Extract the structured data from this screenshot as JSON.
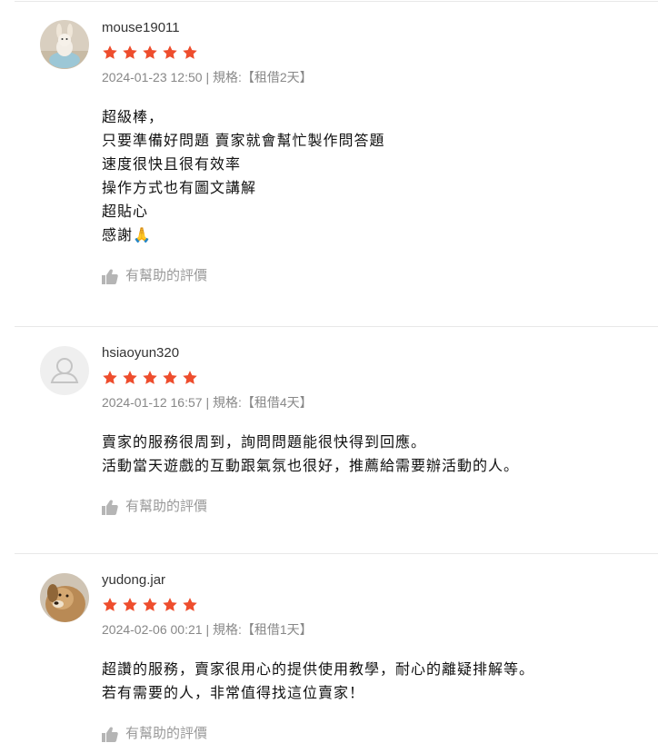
{
  "reviews": [
    {
      "username": "mouse19011",
      "rating": 5,
      "date": "2024-01-23 12:50",
      "separator": "|",
      "spec": "規格:【租借2天】",
      "lines": [
        "超級棒，",
        "只要準備好問題 賣家就會幫忙製作問答題",
        "速度很快且很有效率",
        "操作方式也有圖文講解",
        "超貼心",
        "感謝🙏"
      ],
      "helpful_label": "有幫助的評價",
      "avatar": "rabbit-figurine-photo"
    },
    {
      "username": "hsiaoyun320",
      "rating": 5,
      "date": "2024-01-12 16:57",
      "separator": "|",
      "spec": "規格:【租借4天】",
      "lines": [
        "賣家的服務很周到，詢問問題能很快得到回應。",
        "活動當天遊戲的互動跟氣氛也很好，推薦給需要辦活動的人。"
      ],
      "helpful_label": "有幫助的評價",
      "avatar": "default-user"
    },
    {
      "username": "yudong.jar",
      "rating": 5,
      "date": "2024-02-06 00:21",
      "separator": "|",
      "spec": "規格:【租借1天】",
      "lines": [
        "超讚的服務，賣家很用心的提供使用教學，耐心的離疑排解等。",
        "若有需要的人，非常值得找這位賣家！"
      ],
      "helpful_label": "有幫助的評價",
      "avatar": "dog-photo"
    }
  ],
  "colors": {
    "star": "#ee4d2d",
    "meta": "#888888",
    "divider": "#e8e8e8"
  }
}
